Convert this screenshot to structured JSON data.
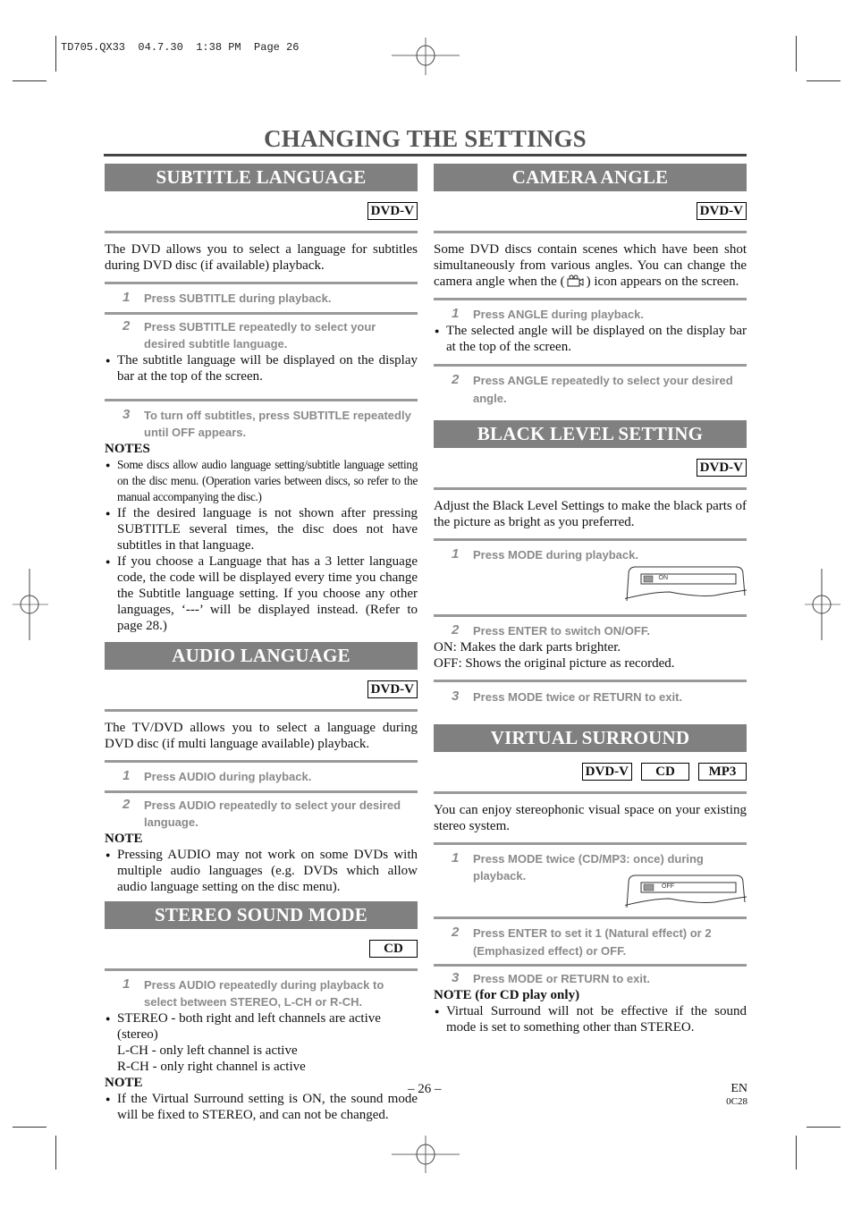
{
  "print_header": "TD705.QX33  04.7.30  1:38 PM  Page 26",
  "page_title": "CHANGING THE SETTINGS",
  "left_column": {
    "subtitle_language": {
      "heading": "SUBTITLE LANGUAGE",
      "badges": [
        "DVD-V"
      ],
      "intro": "The DVD allows you to select a language for subtitles during DVD disc (if available) playback.",
      "steps": [
        {
          "num": "1",
          "text": "Press SUBTITLE during playback."
        },
        {
          "num": "2",
          "text": "Press SUBTITLE repeatedly to select your desired subtitle language."
        },
        {
          "num": "3",
          "text": "To turn off subtitles, press SUBTITLE repeatedly until OFF appears."
        }
      ],
      "step2_bullet": "The subtitle language will be displayed on the display bar at the top of the screen.",
      "notes_heading": "NOTES",
      "notes": [
        "Some discs allow audio language setting/subtitle language setting on the disc menu. (Operation varies between discs, so refer to the manual accompanying the disc.)",
        "If the desired language is not shown after pressing SUBTITLE several times, the disc does not have subtitles in that language.",
        "If you choose a Language that has a 3 letter language code, the code will be displayed every time you change the Subtitle language setting. If you choose any other languages, ‘---’ will be displayed instead. (Refer to page 28.)"
      ]
    },
    "audio_language": {
      "heading": "AUDIO LANGUAGE",
      "badges": [
        "DVD-V"
      ],
      "intro": "The TV/DVD allows you to select a language during DVD disc (if multi language available) playback.",
      "steps": [
        {
          "num": "1",
          "text": "Press AUDIO during playback."
        },
        {
          "num": "2",
          "text": "Press AUDIO repeatedly to select your desired language."
        }
      ],
      "note_heading": "NOTE",
      "notes": [
        "Pressing AUDIO may not work on some DVDs with multiple audio languages (e.g. DVDs which allow audio language setting on the disc menu)."
      ]
    },
    "stereo_sound_mode": {
      "heading": "STEREO SOUND MODE",
      "badges": [
        "CD"
      ],
      "steps": [
        {
          "num": "1",
          "text": "Press AUDIO repeatedly during playback to select between STEREO, L-CH or R-CH."
        }
      ],
      "bullet": "STEREO - both right and left channels are active (stereo)",
      "lines": [
        "L-CH - only left channel is active",
        "R-CH - only right channel is active"
      ],
      "note_heading": "NOTE",
      "notes": [
        "If the Virtual Surround setting is ON, the sound mode will be fixed to STEREO, and can not be changed."
      ]
    }
  },
  "right_column": {
    "camera_angle": {
      "heading": "CAMERA ANGLE",
      "badges": [
        "DVD-V"
      ],
      "intro_before_icon": "Some DVD discs contain scenes which have been shot simultaneously from various angles. You can change the camera angle when the (",
      "intro_icon": "camera-angle-icon",
      "intro_after_icon": ") icon appears on the screen.",
      "steps": [
        {
          "num": "1",
          "text": "Press ANGLE during playback."
        },
        {
          "num": "2",
          "text": "Press ANGLE repeatedly to select your desired angle."
        }
      ],
      "step1_bullet": "The selected angle will be displayed on the display bar at the top of the screen."
    },
    "black_level_setting": {
      "heading": "BLACK LEVEL SETTING",
      "badges": [
        "DVD-V"
      ],
      "intro": "Adjust the Black Level Settings to make the black parts of the picture as bright as you preferred.",
      "steps": [
        {
          "num": "1",
          "text": "Press MODE during playback."
        },
        {
          "num": "2",
          "text": "Press ENTER to switch ON/OFF."
        },
        {
          "num": "3",
          "text": "Press MODE twice or RETURN to exit."
        }
      ],
      "osd_value": "ON",
      "lines": [
        "ON: Makes the dark parts brighter.",
        "OFF: Shows the original picture as recorded."
      ]
    },
    "virtual_surround": {
      "heading": "VIRTUAL SURROUND",
      "badges": [
        "DVD-V",
        "CD",
        "MP3"
      ],
      "intro": "You can enjoy stereophonic visual space on your existing stereo system.",
      "steps": [
        {
          "num": "1",
          "text": "Press MODE twice (CD/MP3: once) during playback."
        },
        {
          "num": "2",
          "text": "Press ENTER to set it 1 (Natural effect) or 2 (Emphasized effect) or OFF."
        },
        {
          "num": "3",
          "text": "Press MODE or RETURN to exit."
        }
      ],
      "osd_value": "OFF",
      "note_heading": "NOTE (for CD play only)",
      "notes": [
        "Virtual Surround will not be effective if the sound mode is set to something other than STEREO."
      ]
    }
  },
  "footer": {
    "page_number": "– 26 –",
    "lang": "EN",
    "code": "0C28"
  }
}
